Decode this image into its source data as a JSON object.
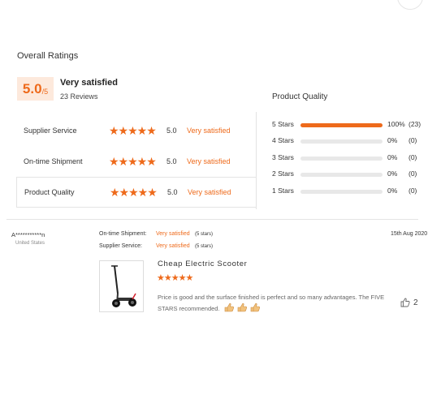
{
  "summary": {
    "title": "Overall Ratings",
    "score": "5.0",
    "score_suffix": "/5",
    "verdict": "Very satisfied",
    "reviews": "23 Reviews",
    "accent_color": "#ee6a1b"
  },
  "ratings": [
    {
      "label": "Supplier Service",
      "stars": "★★★★★",
      "score": "5.0",
      "verdict": "Very satisfied"
    },
    {
      "label": "On-time Shipment",
      "stars": "★★★★★",
      "score": "5.0",
      "verdict": "Very satisfied"
    },
    {
      "label": "Product Quality",
      "stars": "★★★★★",
      "score": "5.0",
      "verdict": "Very satisfied"
    }
  ],
  "quality": {
    "title": "Product Quality",
    "distribution": [
      {
        "label": "5 Stars",
        "fraction": 1.0,
        "percent": "100%",
        "count": "(23)"
      },
      {
        "label": "4 Stars",
        "fraction": 0,
        "percent": "0%",
        "count": "(0)"
      },
      {
        "label": "3 Stars",
        "fraction": 0,
        "percent": "0%",
        "count": "(0)"
      },
      {
        "label": "2 Stars",
        "fraction": 0,
        "percent": "0%",
        "count": "(0)"
      },
      {
        "label": "1 Stars",
        "fraction": 0,
        "percent": "0%",
        "count": "(0)"
      }
    ]
  },
  "review": {
    "reviewer": "A***********n",
    "country": "United States",
    "shipment_label": "On-time Shipment:",
    "shipment_value": "Very satisfied",
    "shipment_stars": "(5 stars)",
    "service_label": "Supplier Service:",
    "service_value": "Very satisfied",
    "service_stars": "(5 stars)",
    "date": "15th Aug 2020",
    "product_name": "Cheap Electric Scooter",
    "product_stars": "★★★★★",
    "text": "Price is good and the surface finished is perfect and so many advantages. The FIVE STARS recommended.",
    "likes": "2"
  }
}
